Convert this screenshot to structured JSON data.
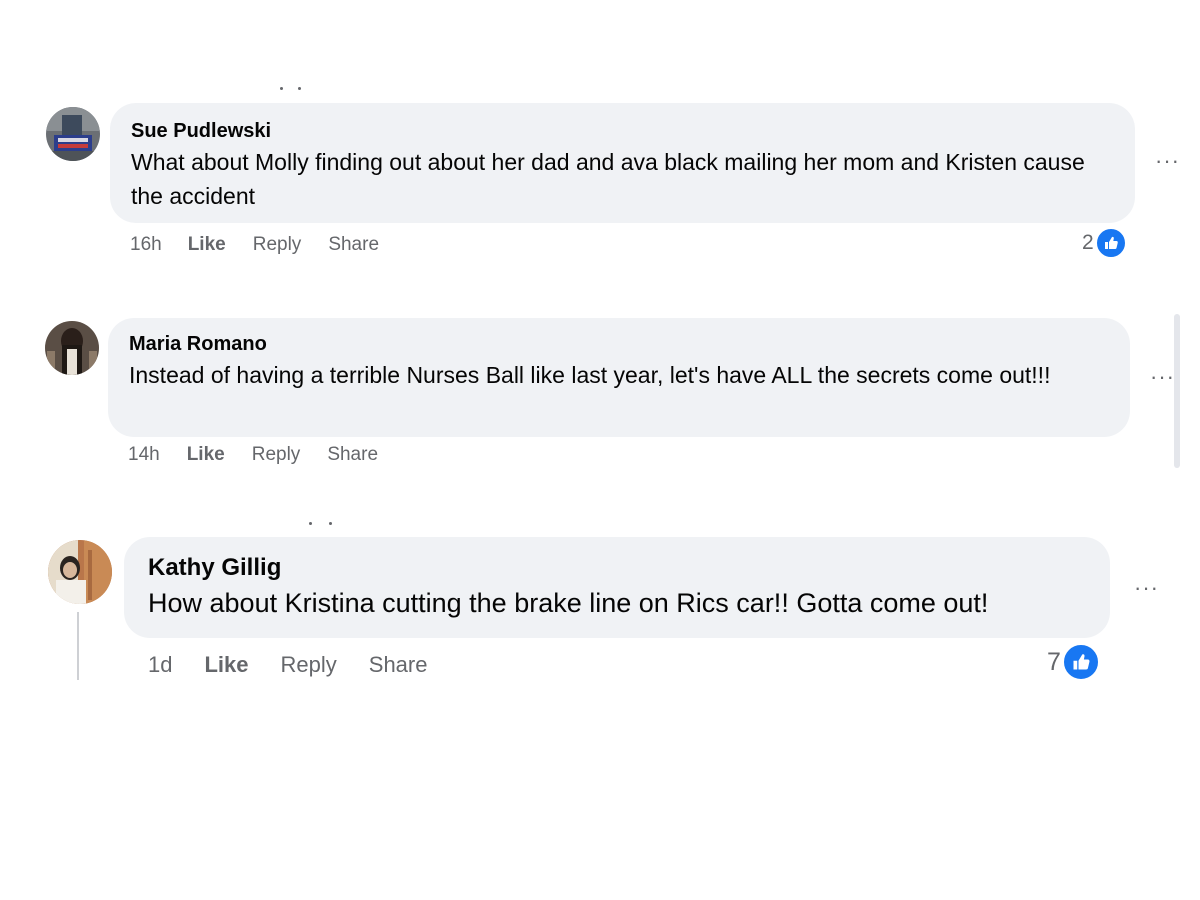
{
  "colors": {
    "bubble": "#f0f2f5",
    "secondary_text": "#65676b",
    "like_blue": "#1877f2"
  },
  "icons": {
    "more": "more-horizontal-icon",
    "like_reaction": "thumbs-up-icon"
  },
  "comments": [
    {
      "author": "Sue Pudlewski",
      "text": "What about Molly finding out about her dad and ava black mailing her mom and Kristen cause the accident",
      "time": "16h",
      "like_label": "Like",
      "reply_label": "Reply",
      "share_label": "Share",
      "more_label": "···",
      "reaction_count": "2"
    },
    {
      "author": "Maria Romano",
      "text": "Instead of having a terrible Nurses Ball like last year, let's have ALL the secrets come out!!!",
      "time": "14h",
      "like_label": "Like",
      "reply_label": "Reply",
      "share_label": "Share",
      "more_label": "···"
    },
    {
      "author": "Kathy Gillig",
      "text": "How about Kristina cutting the brake line on Rics car!! Gotta come out!",
      "time": "1d",
      "like_label": "Like",
      "reply_label": "Reply",
      "share_label": "Share",
      "more_label": "···",
      "reaction_count": "7"
    }
  ]
}
